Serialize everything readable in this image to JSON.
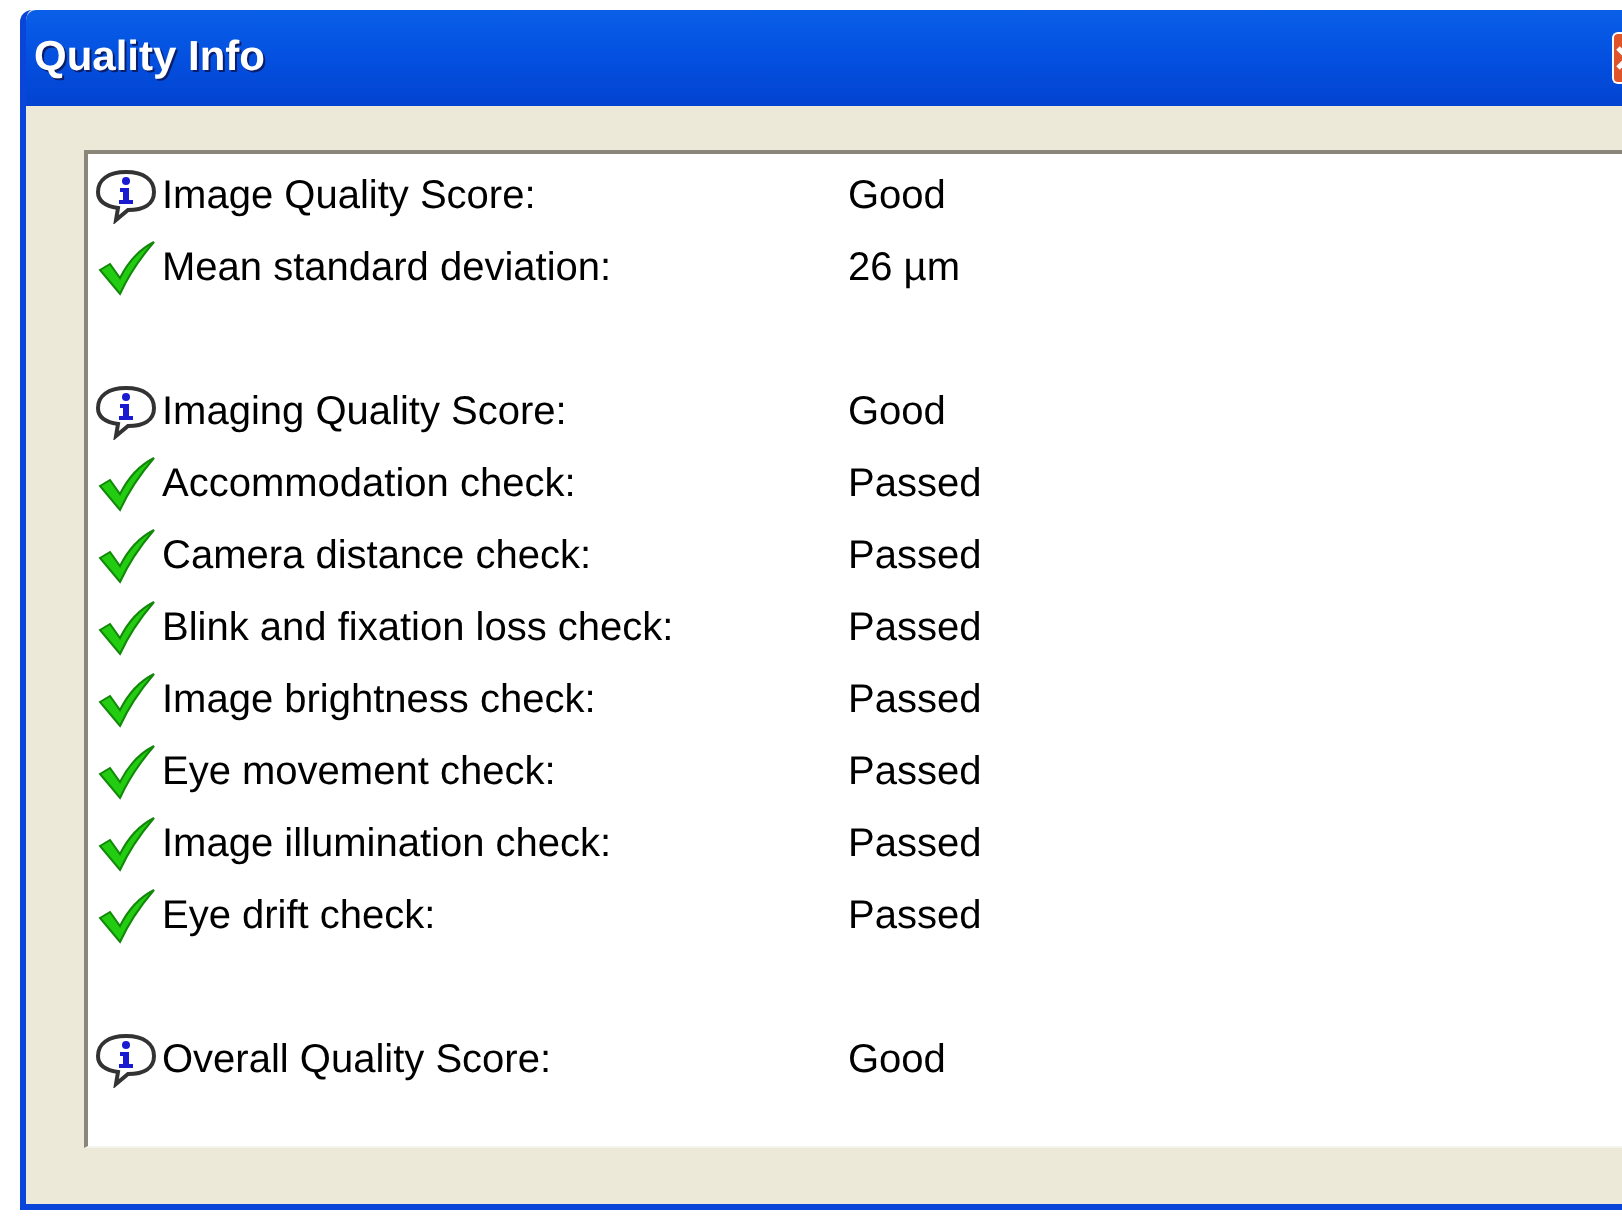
{
  "window": {
    "title": "Quality Info"
  },
  "groups": [
    {
      "items": [
        {
          "kind": "info",
          "label": "Image Quality Score:",
          "value": "Good"
        },
        {
          "kind": "check",
          "label": "Mean standard deviation:",
          "value": "26 µm"
        }
      ]
    },
    {
      "items": [
        {
          "kind": "info",
          "label": "Imaging Quality Score:",
          "value": "Good"
        },
        {
          "kind": "check",
          "label": "Accommodation check:",
          "value": "Passed"
        },
        {
          "kind": "check",
          "label": "Camera distance check:",
          "value": "Passed"
        },
        {
          "kind": "check",
          "label": "Blink and fixation loss check:",
          "value": "Passed"
        },
        {
          "kind": "check",
          "label": "Image brightness check:",
          "value": "Passed"
        },
        {
          "kind": "check",
          "label": "Eye movement check:",
          "value": "Passed"
        },
        {
          "kind": "check",
          "label": "Image illumination check:",
          "value": "Passed"
        },
        {
          "kind": "check",
          "label": "Eye drift check:",
          "value": "Passed"
        }
      ]
    },
    {
      "items": [
        {
          "kind": "info",
          "label": "Overall Quality Score:",
          "value": "Good"
        }
      ]
    }
  ]
}
